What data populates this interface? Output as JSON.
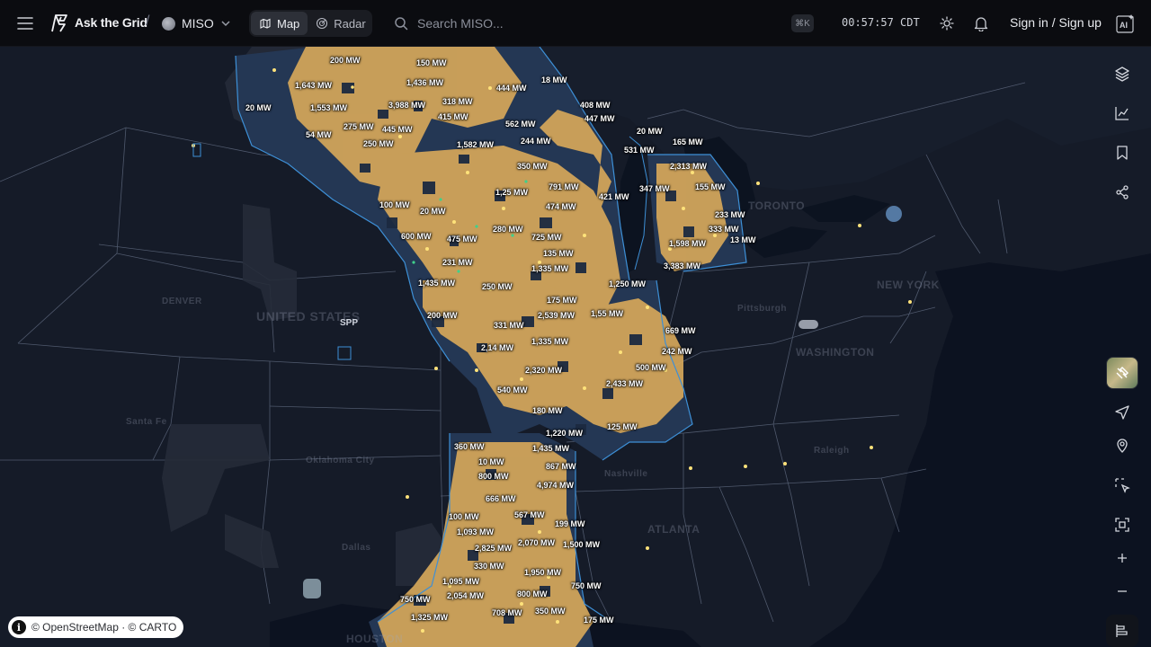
{
  "header": {
    "brand": "Ask the Grid",
    "separator": "/",
    "iso": "MISO",
    "tabs": [
      {
        "label": "Map",
        "active": true
      },
      {
        "label": "Radar",
        "active": false
      }
    ],
    "search_placeholder": "Search MISO...",
    "shortcut": "⌘K",
    "clock": "00:57:57 CDT",
    "sign_in": "Sign in / Sign up",
    "ai_label": "AI"
  },
  "map": {
    "region_label": "SPP",
    "city_labels": [
      "UNITED STATES",
      "DENVER",
      "Oklahoma City",
      "Dallas",
      "ATLANTA",
      "Nashville",
      "WASHINGTON",
      "NEW YORK",
      "TORONTO",
      "Pittsburgh",
      "Raleigh",
      "HOUSTON",
      "Santa Fe"
    ],
    "capacity_labels": [
      "200 MW",
      "150 MW",
      "1,643 MW",
      "1,436 MW",
      "444 MW",
      "18 MW",
      "20 MW",
      "1,553 MW",
      "3,988 MW",
      "318 MW",
      "408 MW",
      "415 MW",
      "447 MW",
      "275 MW",
      "445 MW",
      "562 MW",
      "54 MW",
      "250 MW",
      "20 MW",
      "1,582 MW",
      "244 MW",
      "165 MW",
      "531 MW",
      "350 MW",
      "2,313 MW",
      "155 MW",
      "347 MW",
      "791 MW",
      "421 MW",
      "1,25 MW",
      "474 MW",
      "100 MW",
      "233 MW",
      "20 MW",
      "333 MW",
      "600 MW",
      "475 MW",
      "280 MW",
      "725 MW",
      "1,598 MW",
      "13 MW",
      "231 MW",
      "135 MW",
      "3,383 MW",
      "1,335 MW",
      "1,435 MW",
      "250 MW",
      "1,250 MW",
      "175 MW",
      "200 MW",
      "2,539 MW",
      "1,55 MW",
      "331 MW",
      "669 MW",
      "2,14 MW",
      "1,335 MW",
      "242 MW",
      "2,320 MW",
      "500 MW",
      "540 MW",
      "2,433 MW",
      "180 MW",
      "1,220 MW",
      "125 MW",
      "360 MW",
      "1,435 MW",
      "10 MW",
      "867 MW",
      "800 MW",
      "4,974 MW",
      "666 MW",
      "567 MW",
      "100 MW",
      "199 MW",
      "1,093 MW",
      "2,825 MW",
      "2,070 MW",
      "1,500 MW",
      "330 MW",
      "1,950 MW",
      "1,095 MW",
      "750 MW",
      "2,054 MW",
      "800 MW",
      "750 MW",
      "708 MW",
      "350 MW",
      "1,325 MW",
      "175 MW"
    ]
  },
  "right_toolbar": [
    "layers-icon",
    "chart-icon",
    "bookmark-icon",
    "share-icon",
    "satellite-toggle",
    "locate-icon",
    "pin-icon",
    "select-icon",
    "fit-icon",
    "zoom-in-icon",
    "zoom-out-icon",
    "legend-icon"
  ],
  "attribution": "© OpenStreetMap · © CARTO",
  "colors": {
    "topbar": "#0b0c10",
    "map_base": "#141a26",
    "miso_fill": "#d9aa5a",
    "miso_dark": "#2b3a52",
    "border": "#3d8fd6"
  }
}
